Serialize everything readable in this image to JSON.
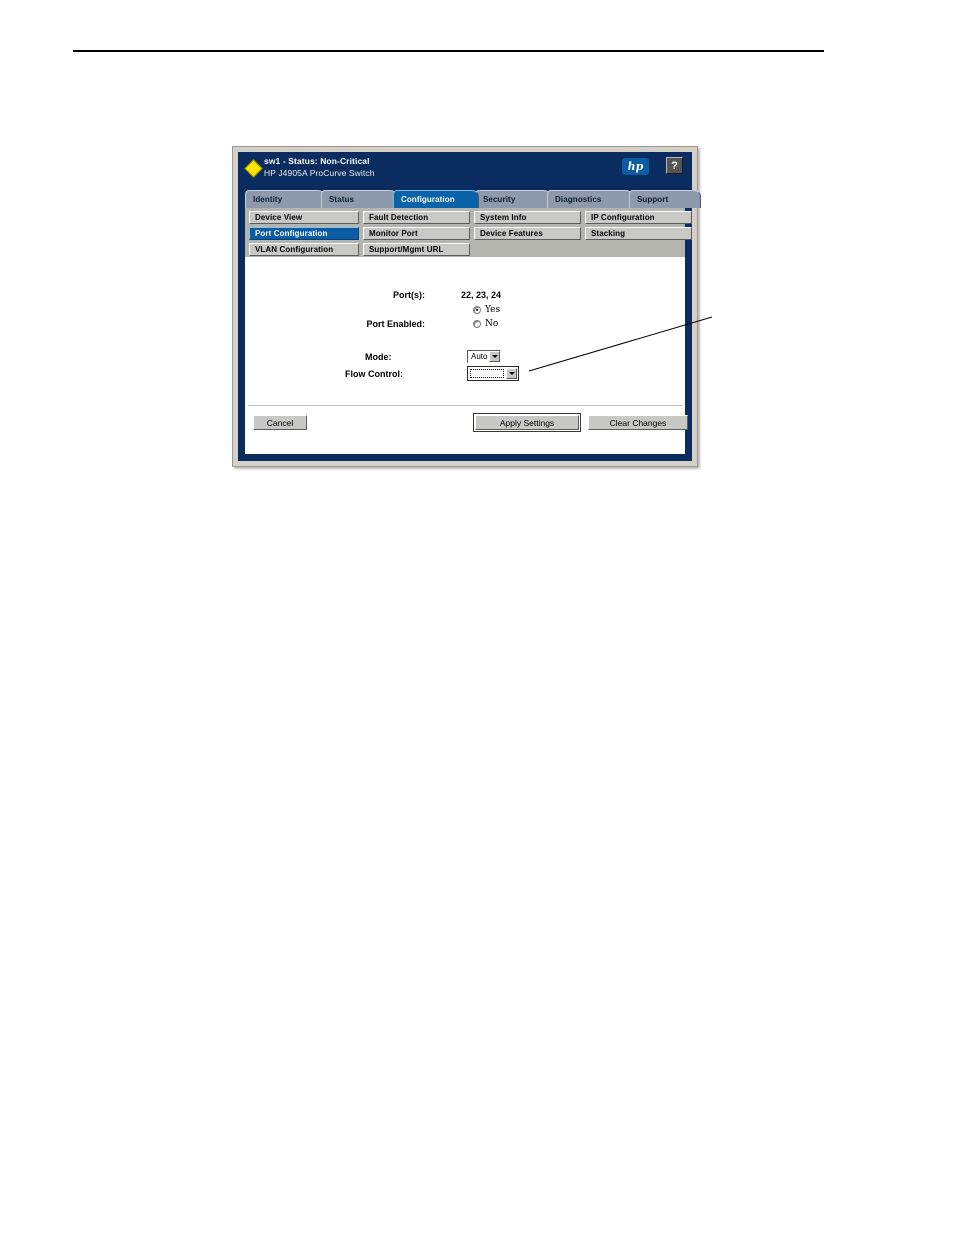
{
  "window": {
    "status_indicator": "yellow-diamond",
    "title_line1": "sw1 - Status: Non-Critical",
    "title_line2": "HP J4905A ProCurve Switch",
    "logo_text": "hp",
    "help_label": "?",
    "accent_color": "#0a5ca4",
    "titlebar_color": "#0b2c5e"
  },
  "tabs": [
    {
      "label": "Identity",
      "active": false
    },
    {
      "label": "Status",
      "active": false
    },
    {
      "label": "Configuration",
      "active": true
    },
    {
      "label": "Security",
      "active": false
    },
    {
      "label": "Diagnostics",
      "active": false
    },
    {
      "label": "Support",
      "active": false
    }
  ],
  "subtabs": [
    {
      "label": "Device View",
      "selected": false
    },
    {
      "label": "Fault Detection",
      "selected": false
    },
    {
      "label": "System Info",
      "selected": false
    },
    {
      "label": "IP Configuration",
      "selected": false
    },
    {
      "label": "Port Configuration",
      "selected": true
    },
    {
      "label": "Monitor Port",
      "selected": false
    },
    {
      "label": "Device Features",
      "selected": false
    },
    {
      "label": "Stacking",
      "selected": false
    },
    {
      "label": "VLAN Configuration",
      "selected": false
    },
    {
      "label": "Support/Mgmt URL",
      "selected": false
    }
  ],
  "form": {
    "ports_label": "Port(s):",
    "ports_value": "22, 23, 24",
    "port_enabled_label": "Port Enabled:",
    "radio_yes_label": "Yes",
    "radio_no_label": "No",
    "radio_selected": "Yes",
    "mode_label": "Mode:",
    "mode_value": "Auto",
    "flow_control_label": "Flow Control:",
    "flow_control_value": ""
  },
  "footer": {
    "cancel_label": "Cancel",
    "apply_label": "Apply Settings",
    "clear_label": "Clear Changes"
  }
}
